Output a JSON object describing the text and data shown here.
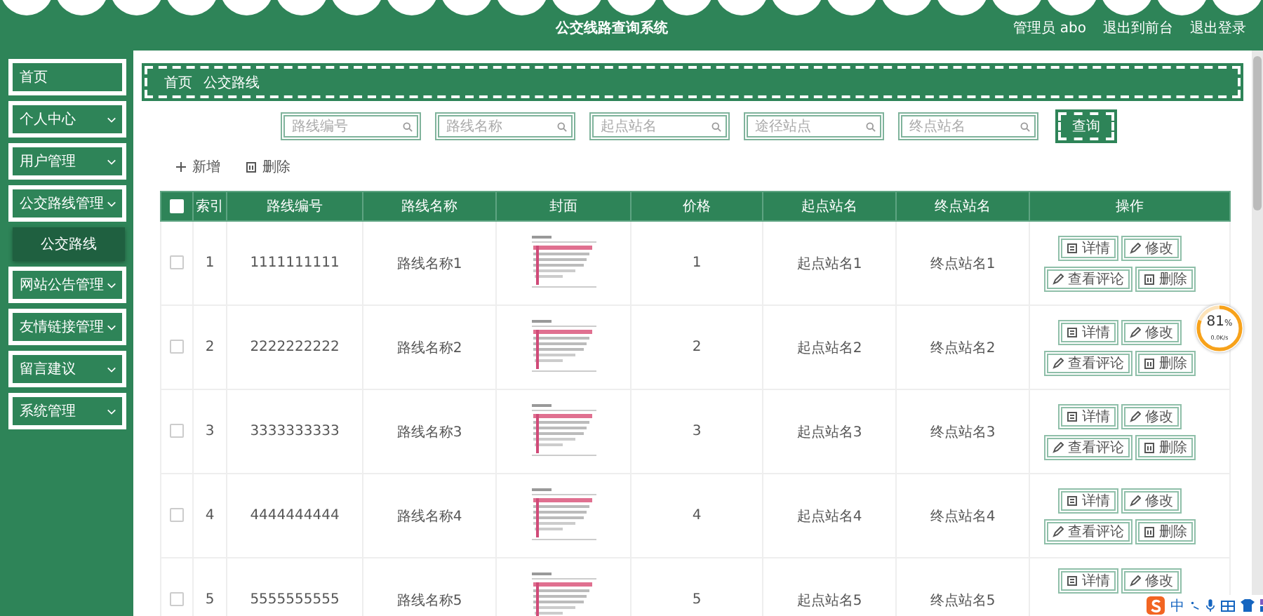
{
  "header": {
    "title": "公交线路查询系统",
    "user": "管理员 abo",
    "links": [
      "退出到前台",
      "退出登录"
    ]
  },
  "sidebar": {
    "items": [
      {
        "label": "首页",
        "kind": "link"
      },
      {
        "label": "个人中心",
        "kind": "group"
      },
      {
        "label": "用户管理",
        "kind": "group"
      },
      {
        "label": "公交路线管理",
        "kind": "group",
        "children": [
          {
            "label": "公交路线",
            "selected": true
          }
        ]
      },
      {
        "label": "网站公告管理",
        "kind": "group"
      },
      {
        "label": "友情链接管理",
        "kind": "group"
      },
      {
        "label": "留言建议",
        "kind": "group"
      },
      {
        "label": "系统管理",
        "kind": "group"
      }
    ]
  },
  "breadcrumb": [
    "首页",
    "公交路线"
  ],
  "search": {
    "fields": [
      {
        "placeholder": "路线编号"
      },
      {
        "placeholder": "路线名称"
      },
      {
        "placeholder": "起点站名"
      },
      {
        "placeholder": "途径站点"
      },
      {
        "placeholder": "终点站名"
      }
    ],
    "button": "查询"
  },
  "actions": [
    {
      "label": "新增",
      "kind": "add"
    },
    {
      "label": "删除",
      "kind": "delete"
    }
  ],
  "table": {
    "select_all": false,
    "columns": [
      "索引",
      "路线编号",
      "路线名称",
      "封面",
      "价格",
      "起点站名",
      "终点站名",
      "操作"
    ],
    "rows": [
      {
        "checked": false,
        "index": "1",
        "code": "1111111111",
        "name": "路线名称1",
        "cover": {
          "kind": "picture"
        },
        "price": "1",
        "start": "起点站名1",
        "end": "终点站名1",
        "buttons": [
          {
            "label": "详情",
            "kind": "detail"
          },
          {
            "label": "修改",
            "kind": "edit"
          },
          {
            "label": "查看评论",
            "kind": "edit"
          },
          {
            "label": "删除",
            "kind": "delete"
          }
        ]
      },
      {
        "checked": false,
        "index": "2",
        "code": "2222222222",
        "name": "路线名称2",
        "cover": {
          "kind": "picture"
        },
        "price": "2",
        "start": "起点站名2",
        "end": "终点站名2",
        "buttons": [
          {
            "label": "详情",
            "kind": "detail"
          },
          {
            "label": "修改",
            "kind": "edit"
          },
          {
            "label": "查看评论",
            "kind": "edit"
          },
          {
            "label": "删除",
            "kind": "delete"
          }
        ]
      },
      {
        "checked": false,
        "index": "3",
        "code": "3333333333",
        "name": "路线名称3",
        "cover": {
          "kind": "picture"
        },
        "price": "3",
        "start": "起点站名3",
        "end": "终点站名3",
        "buttons": [
          {
            "label": "详情",
            "kind": "detail"
          },
          {
            "label": "修改",
            "kind": "edit"
          },
          {
            "label": "查看评论",
            "kind": "edit"
          },
          {
            "label": "删除",
            "kind": "delete"
          }
        ]
      },
      {
        "checked": false,
        "index": "4",
        "code": "4444444444",
        "name": "路线名称4",
        "cover": {
          "kind": "picture"
        },
        "price": "4",
        "start": "起点站名4",
        "end": "终点站名4",
        "buttons": [
          {
            "label": "详情",
            "kind": "detail"
          },
          {
            "label": "修改",
            "kind": "edit"
          },
          {
            "label": "查看评论",
            "kind": "edit"
          },
          {
            "label": "删除",
            "kind": "delete"
          }
        ]
      },
      {
        "checked": false,
        "index": "5",
        "code": "5555555555",
        "name": "路线名称5",
        "cover": {
          "kind": "picture"
        },
        "price": "5",
        "start": "起点站名5",
        "end": "终点站名5",
        "buttons": [
          {
            "label": "详情",
            "kind": "detail"
          },
          {
            "label": "修改",
            "kind": "edit"
          }
        ]
      }
    ]
  },
  "speed_widget": {
    "percent": "81",
    "unit": "%",
    "speed": "0.0K/s",
    "level": 0.81
  },
  "ime_toolbar": {
    "label": "中"
  }
}
